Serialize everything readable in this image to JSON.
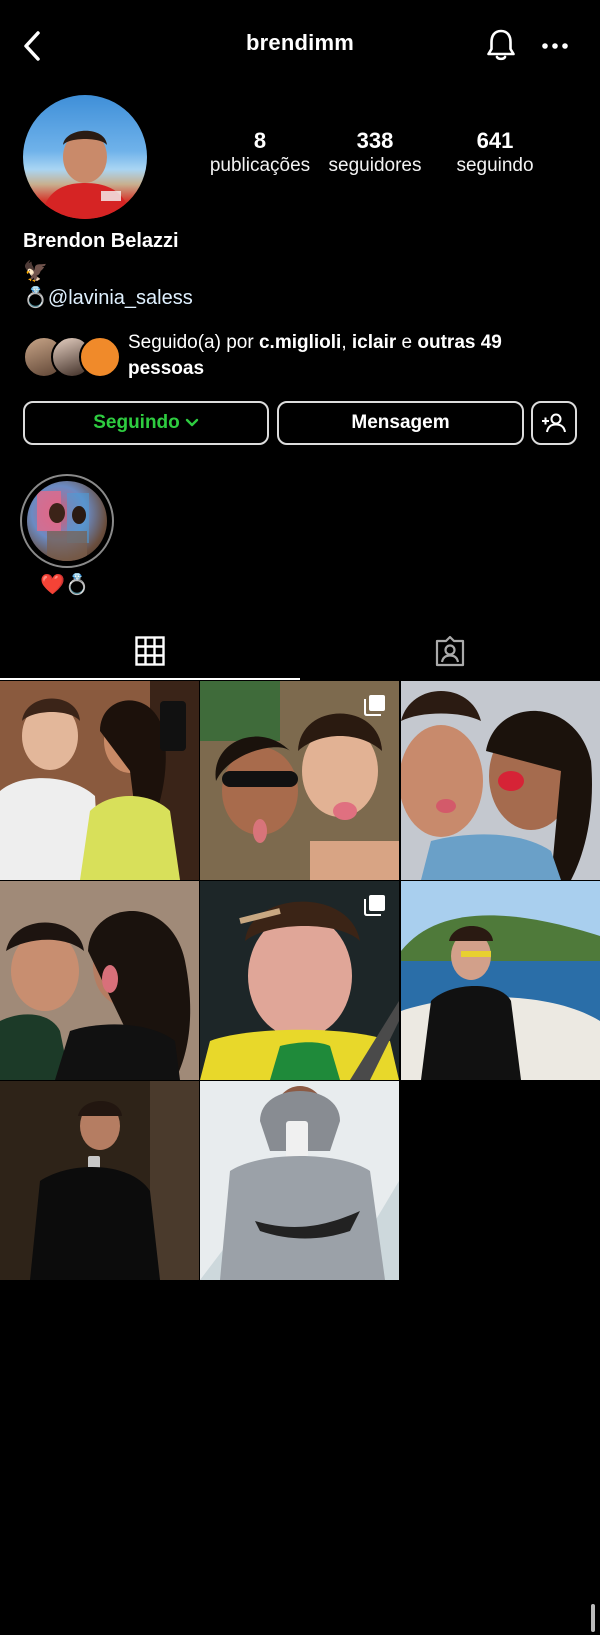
{
  "header": {
    "username": "brendimm",
    "icons": {
      "back": "chevron-left-icon",
      "notifications": "bell-icon",
      "more": "more-horizontal-icon"
    }
  },
  "stats": {
    "posts": {
      "value": "8",
      "label": "publicações"
    },
    "followers": {
      "value": "338",
      "label": "seguidores"
    },
    "following": {
      "value": "641",
      "label": "seguindo"
    }
  },
  "profile": {
    "display_name": "Brendon Belazzi",
    "bio_line1_emoji": "🦅",
    "bio_line2_emoji": "💍",
    "bio_mention": "@lavinia_saless"
  },
  "followed_by": {
    "prefix": "Seguido(a) por ",
    "user1": "c.miglioli",
    "separator": ", ",
    "user2": "iclair",
    "connector": " e ",
    "others": "outras 49 pessoas"
  },
  "actions": {
    "following_label": "Seguindo",
    "message_label": "Mensagem"
  },
  "highlights": [
    {
      "label": "❤️💍"
    }
  ],
  "tabs": [
    {
      "name": "posts",
      "icon": "grid-icon",
      "active": true
    },
    {
      "name": "tagged",
      "icon": "tagged-person-icon",
      "active": false
    }
  ],
  "posts": [
    {
      "id": 1,
      "multi": false
    },
    {
      "id": 2,
      "multi": true
    },
    {
      "id": 3,
      "multi": false
    },
    {
      "id": 4,
      "multi": false
    },
    {
      "id": 5,
      "multi": true
    },
    {
      "id": 6,
      "multi": false
    },
    {
      "id": 7,
      "multi": false
    },
    {
      "id": 8,
      "multi": false
    }
  ],
  "colors": {
    "background": "#000000",
    "following_green": "#2ecc40",
    "button_border": "#dcdcdc"
  }
}
